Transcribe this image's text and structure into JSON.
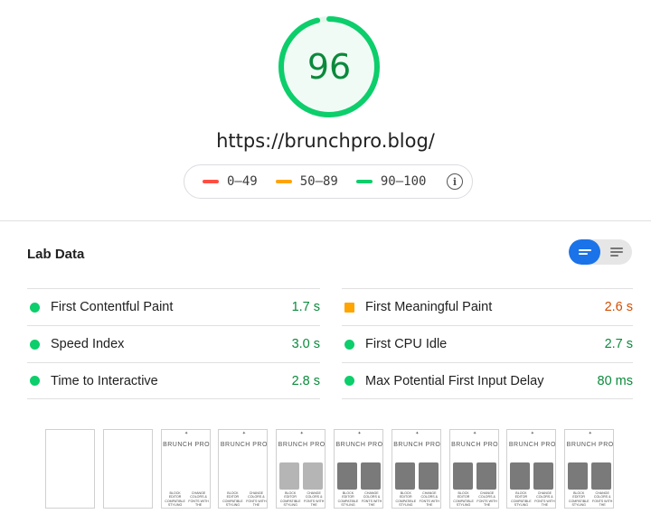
{
  "score": {
    "value": "96",
    "fraction": 0.96,
    "color": "#0cce6b",
    "ring_bg": "#e5f7ec"
  },
  "url": "https://brunchpro.blog/",
  "legend": [
    {
      "range": "0–49",
      "color": "#ff4e42"
    },
    {
      "range": "50–89",
      "color": "#ffa400"
    },
    {
      "range": "90–100",
      "color": "#0cce6b"
    }
  ],
  "legend_info_icon": "info-icon",
  "lab_data": {
    "title": "Lab Data",
    "toggle_icons": [
      "expanded-view-icon",
      "list-view-icon"
    ]
  },
  "metrics": {
    "left": [
      {
        "name": "First Contentful Paint",
        "value": "1.7 s",
        "status": "good",
        "color": "#0b8a3c"
      },
      {
        "name": "Speed Index",
        "value": "3.0 s",
        "status": "good",
        "color": "#0b8a3c"
      },
      {
        "name": "Time to Interactive",
        "value": "2.8 s",
        "status": "good",
        "color": "#0b8a3c"
      }
    ],
    "right": [
      {
        "name": "First Meaningful Paint",
        "value": "2.6 s",
        "status": "average",
        "color": "#d24e00"
      },
      {
        "name": "First CPU Idle",
        "value": "2.7 s",
        "status": "good",
        "color": "#0b8a3c"
      },
      {
        "name": "Max Potential First Input Delay",
        "value": "80 ms",
        "status": "good",
        "color": "#0b8a3c"
      }
    ]
  },
  "filmstrip": {
    "logo": "BRUNCH PRO",
    "star": "✦",
    "caption_left": "BLOCK EDITOR COMPATIBLE STYLING",
    "caption_right": "CHANGE COLORS & FONTS WITH THE CUSTOMIZER",
    "frames": [
      "blank",
      "blank",
      "text",
      "text",
      "full-light",
      "full",
      "full",
      "full",
      "full",
      "full"
    ]
  }
}
